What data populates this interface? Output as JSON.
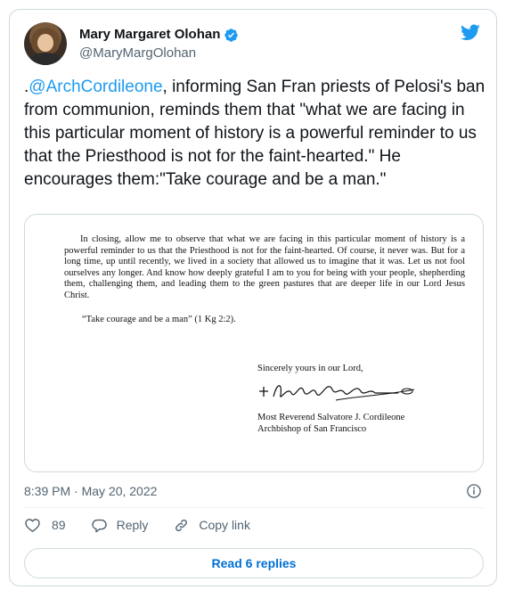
{
  "author": {
    "display_name": "Mary Margaret Olohan",
    "handle": "@MaryMargOlohan"
  },
  "tweet": {
    "prefix": ".",
    "mention": "@ArchCordileone",
    "text": ", informing San Fran priests of Pelosi's ban from communion, reminds them that \"what we are facing in this particular moment of history is a powerful reminder to us that the Priesthood is not for the faint-hearted.\" He encourages them:\"Take courage and be a man.\""
  },
  "letter": {
    "body": "In closing, allow me to observe that what we are facing in this particular moment of history is a powerful reminder to us that the Priesthood is not for the faint-hearted.  Of course, it never was.  But for a long time, up until recently, we lived in a society that allowed us to imagine that it was.  Let us not fool ourselves any longer.  And know how deeply grateful I am to you for being with your people, shepherding them, challenging them, and leading them to the green pastures that are deeper life in our Lord Jesus Christ.",
    "quote": "“Take courage and be a man” (1 Kg 2:2).",
    "closing": "Sincerely yours in our Lord,",
    "signer_name": "Most Reverend Salvatore J. Cordileone",
    "signer_title": "Archbishop of San Francisco"
  },
  "meta": {
    "timestamp": "8:39 PM · May 20, 2022"
  },
  "actions": {
    "like_count": "89",
    "reply_label": "Reply",
    "copy_link_label": "Copy link"
  },
  "read_replies_label": "Read 6 replies",
  "colors": {
    "accent": "#1d9bf0",
    "link_button": "#006fd6",
    "secondary_text": "#536471",
    "border": "#cfd9de"
  },
  "icons": [
    "verified-badge-icon",
    "twitter-bird-icon",
    "info-icon",
    "heart-icon",
    "reply-icon",
    "link-icon"
  ]
}
